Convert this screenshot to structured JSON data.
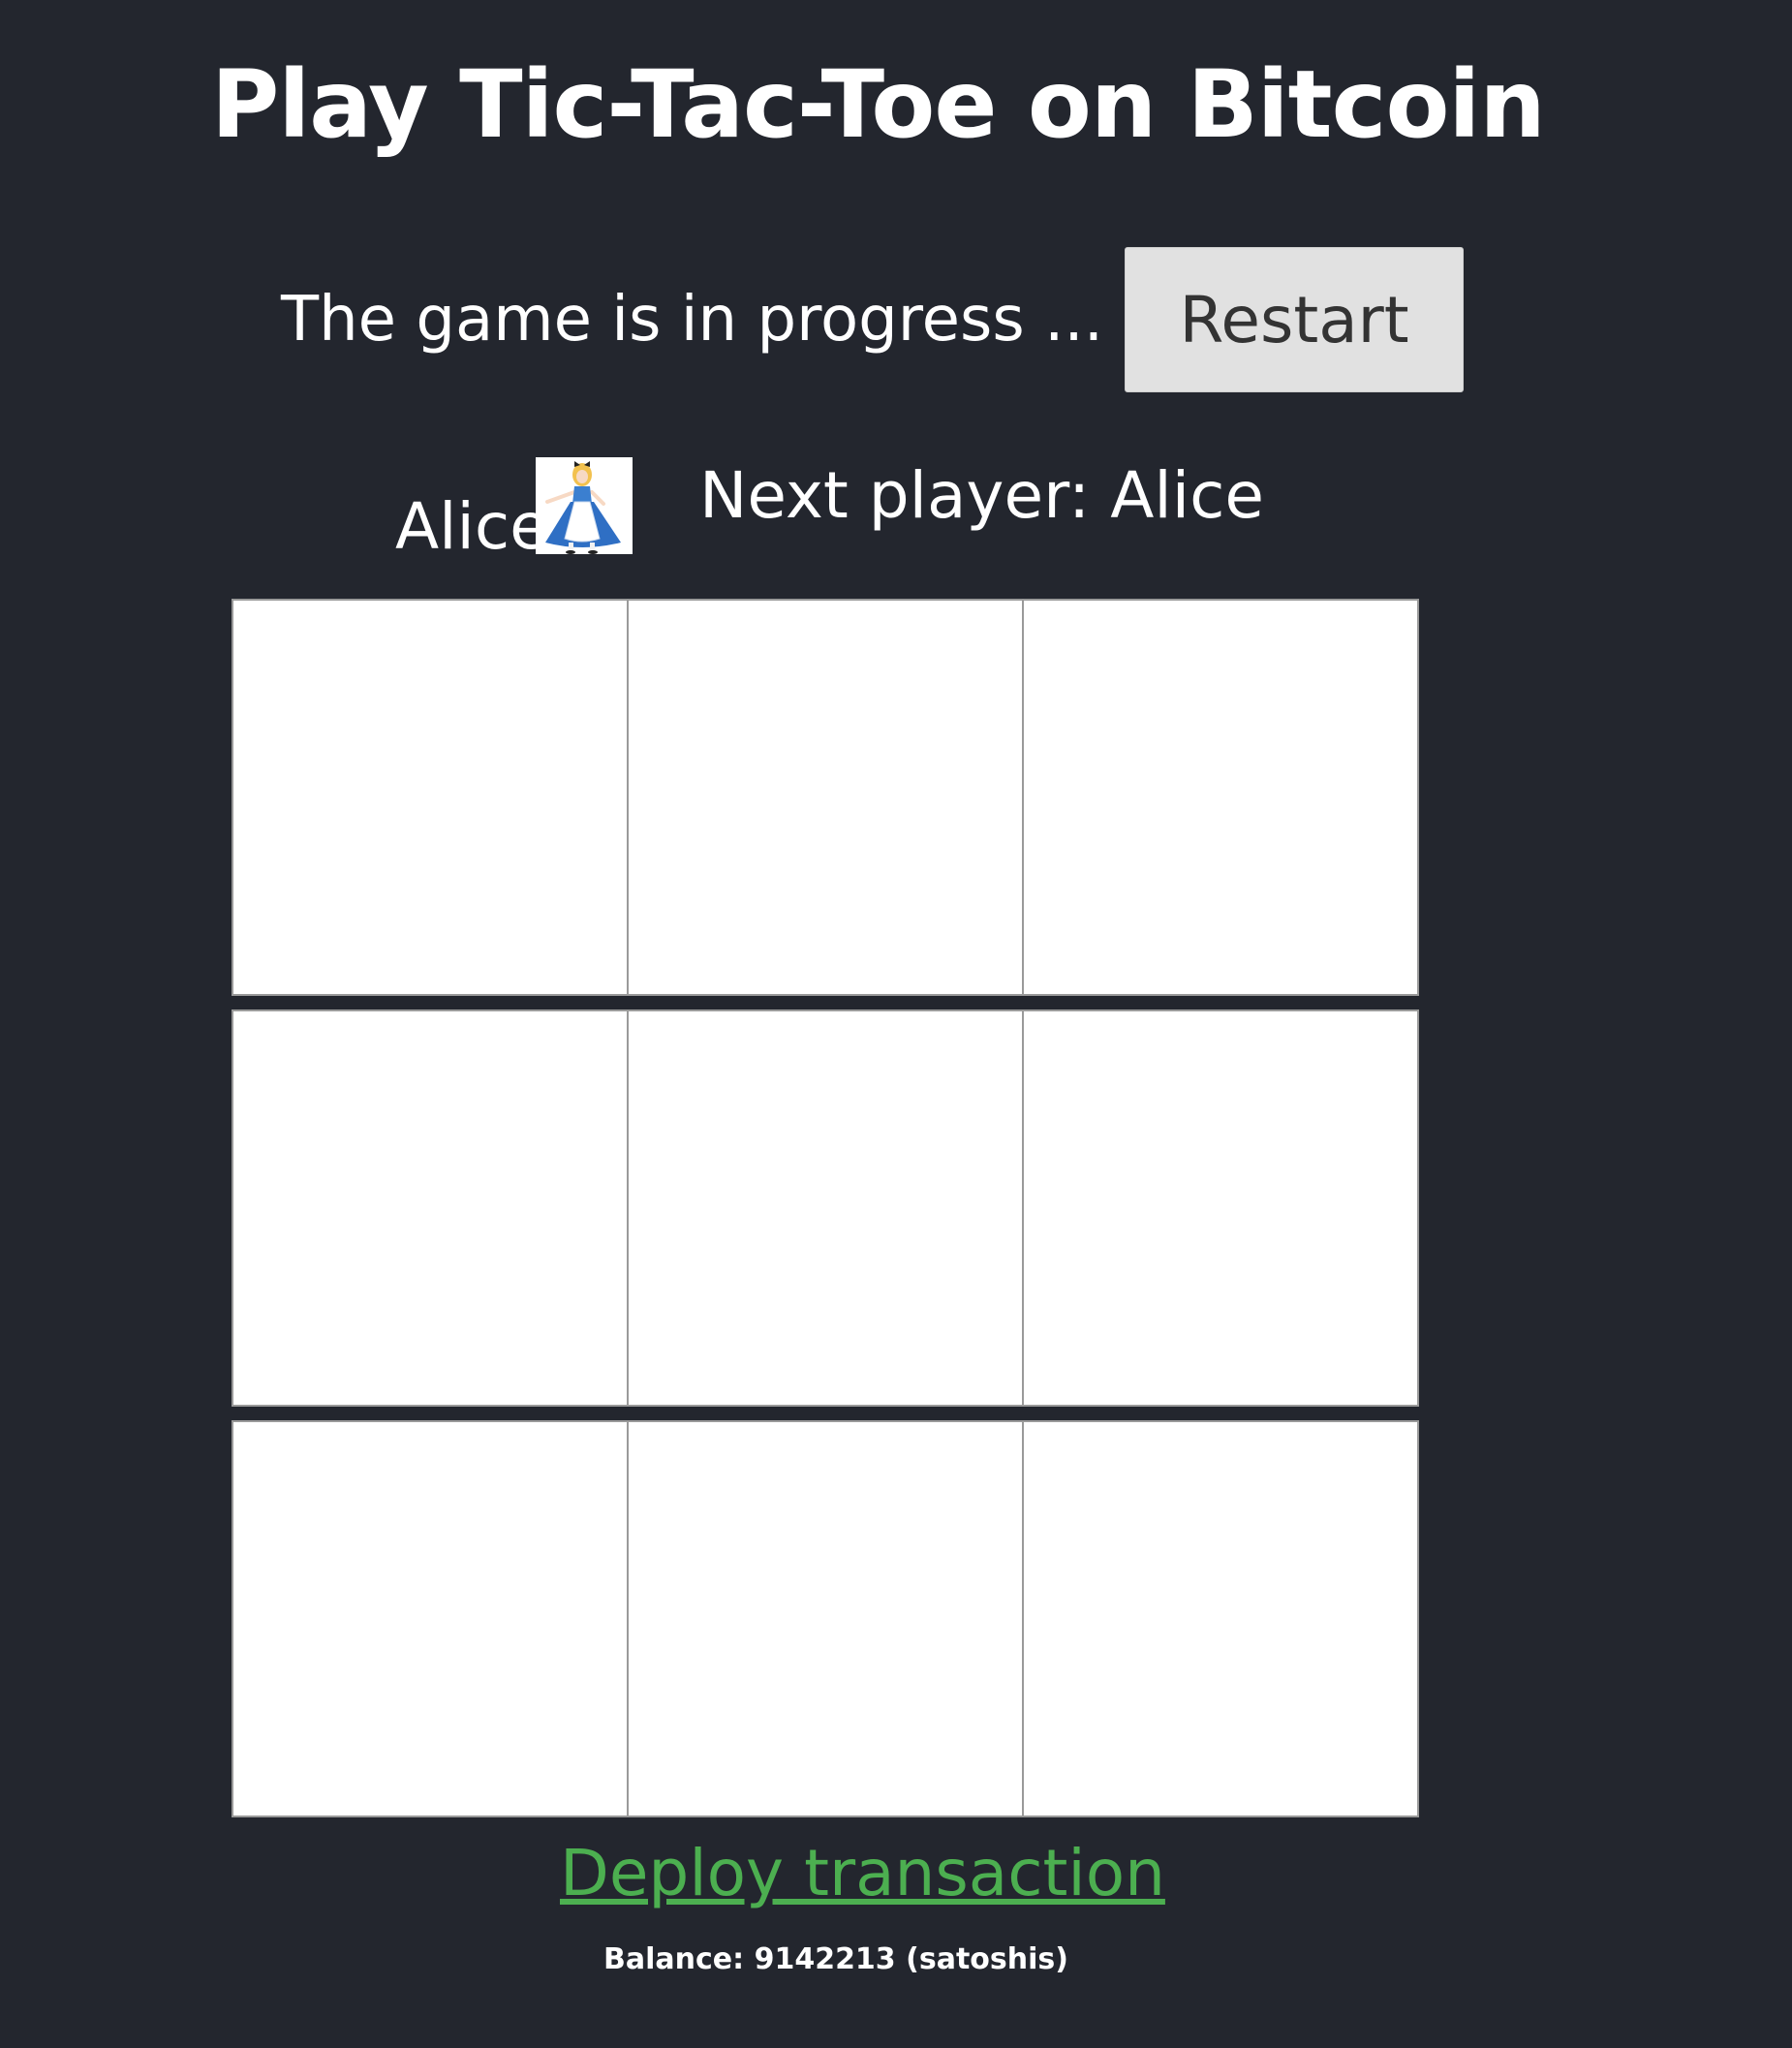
{
  "title": "Play Tic-Tac-Toe on Bitcoin",
  "status": {
    "text": "The game is in progress ...",
    "restart_label": "Restart"
  },
  "player": {
    "name": "Alice",
    "avatar_icon": "alice-avatar-icon",
    "next_player_text": "Next player: Alice"
  },
  "board": {
    "cells": [
      "",
      "",
      "",
      "",
      "",
      "",
      "",
      "",
      ""
    ]
  },
  "footer": {
    "deploy_label": "Deploy transaction",
    "balance_text": "Balance: 9142213 (satoshis)"
  },
  "colors": {
    "background": "#23262e",
    "link": "#4caf50",
    "button": "#e1e1e1"
  }
}
